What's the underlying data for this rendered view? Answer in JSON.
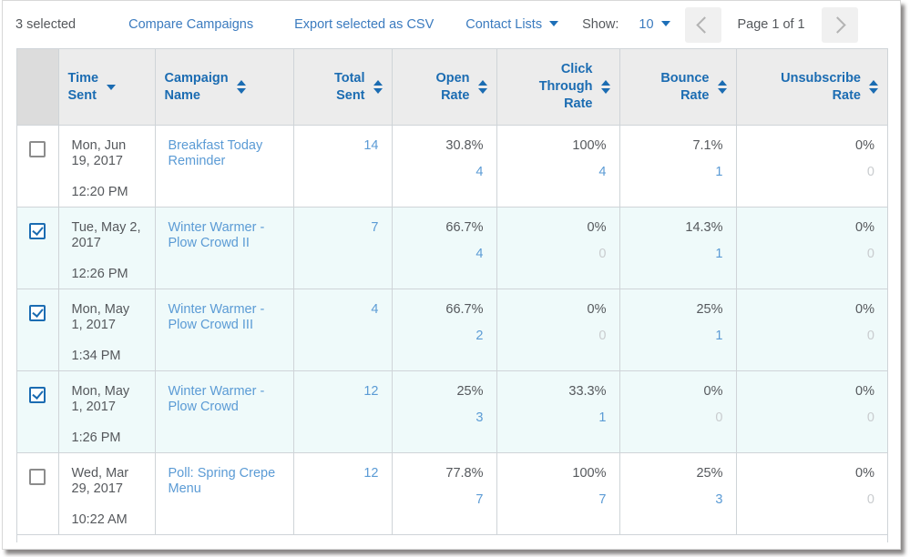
{
  "toolbar": {
    "selected_text": "3 selected",
    "compare_label": "Compare Campaigns",
    "export_label": "Export selected as CSV",
    "contact_lists_label": "Contact Lists",
    "show_label": "Show:",
    "show_value": "10",
    "page_label": "Page 1 of 1",
    "prev_icon": "chevron-left-icon",
    "next_icon": "chevron-right-icon",
    "link_color": "#3b7bbf",
    "text_color": "#55585c"
  },
  "table": {
    "columns": [
      {
        "label": "Time\nSent",
        "align": "left",
        "sort": "desc"
      },
      {
        "label": "Campaign\nName",
        "align": "left",
        "sort": "both"
      },
      {
        "label": "Total\nSent",
        "align": "right",
        "sort": "both"
      },
      {
        "label": "Open\nRate",
        "align": "right",
        "sort": "both"
      },
      {
        "label": "Click\nThrough\nRate",
        "align": "right",
        "sort": "both"
      },
      {
        "label": "Bounce\nRate",
        "align": "right",
        "sort": "both"
      },
      {
        "label": "Unsubscribe\nRate",
        "align": "right",
        "sort": "both"
      }
    ],
    "rows": [
      {
        "selected": false,
        "date": "Mon, Jun 19, 2017",
        "time": "12:20 PM",
        "campaign": "Breakfast Today Reminder",
        "total_sent": "14",
        "open_rate": "30.8%",
        "open_count": "4",
        "ctr_rate": "100%",
        "ctr_count": "4",
        "bounce_rate": "7.1%",
        "bounce_count": "1",
        "unsub_rate": "0%",
        "unsub_count": "0"
      },
      {
        "selected": true,
        "date": "Tue, May 2, 2017",
        "time": "12:26 PM",
        "campaign": "Winter Warmer - Plow Crowd II",
        "total_sent": "7",
        "open_rate": "66.7%",
        "open_count": "4",
        "ctr_rate": "0%",
        "ctr_count": "0",
        "bounce_rate": "14.3%",
        "bounce_count": "1",
        "unsub_rate": "0%",
        "unsub_count": "0"
      },
      {
        "selected": true,
        "date": "Mon, May 1, 2017",
        "time": "1:34 PM",
        "campaign": "Winter Warmer - Plow Crowd III",
        "total_sent": "4",
        "open_rate": "66.7%",
        "open_count": "2",
        "ctr_rate": "0%",
        "ctr_count": "0",
        "bounce_rate": "25%",
        "bounce_count": "1",
        "unsub_rate": "0%",
        "unsub_count": "0"
      },
      {
        "selected": true,
        "date": "Mon, May 1, 2017",
        "time": "1:26 PM",
        "campaign": "Winter Warmer - Plow Crowd",
        "total_sent": "12",
        "open_rate": "25%",
        "open_count": "3",
        "ctr_rate": "33.3%",
        "ctr_count": "1",
        "bounce_rate": "0%",
        "bounce_count": "0",
        "unsub_rate": "0%",
        "unsub_count": "0"
      },
      {
        "selected": false,
        "date": "Wed, Mar 29, 2017",
        "time": "10:22 AM",
        "campaign": "Poll: Spring Crepe Menu",
        "total_sent": "12",
        "open_rate": "77.8%",
        "open_count": "7",
        "ctr_rate": "100%",
        "ctr_count": "7",
        "bounce_rate": "25%",
        "bounce_count": "3",
        "unsub_rate": "0%",
        "unsub_count": "0"
      }
    ]
  },
  "colors": {
    "header_bg": "#ececec",
    "checkbox_header_bg": "#dcdcdc",
    "selected_row_bg": "#effafa",
    "header_text": "#1b6cb2",
    "link": "#5b9bd5",
    "grid_line": "#cfd4d8"
  }
}
